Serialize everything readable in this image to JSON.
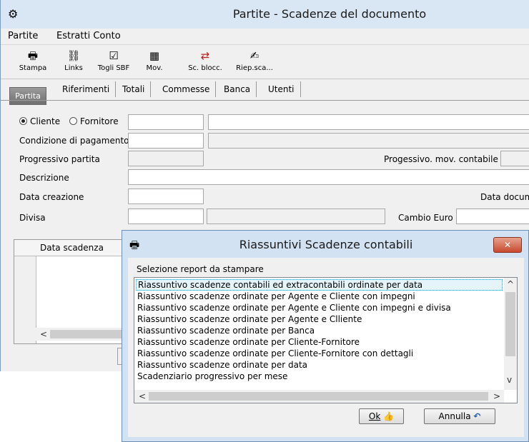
{
  "window": {
    "title": "Partite - Scadenze del documento",
    "app_icon": "gear-icon"
  },
  "menu": {
    "items": [
      "Partite",
      "Estratti Conto"
    ]
  },
  "toolbar": {
    "buttons": [
      {
        "label": "Stampa",
        "icon": "printer-icon",
        "glyph": "🖶"
      },
      {
        "label": "Links",
        "icon": "links-icon",
        "glyph": "⛓"
      },
      {
        "label": "Togli SBF",
        "icon": "checkbox-icon",
        "glyph": "☑"
      },
      {
        "label": "Mov.",
        "icon": "calculator-icon",
        "glyph": "▦"
      },
      {
        "label": "Sc. blocc.",
        "icon": "sync-icon",
        "glyph": "⇄"
      },
      {
        "label": "Riep.sca...",
        "icon": "summary-icon",
        "glyph": "✍"
      }
    ]
  },
  "tabs": {
    "active": "Partita",
    "others": [
      "Riferimenti",
      "Totali",
      "Commesse",
      "Banca",
      "Utenti"
    ]
  },
  "form": {
    "cliente": "Cliente",
    "fornitore": "Fornitore",
    "condizione": "Condizione di pagamento",
    "progressivo_partita": "Progressivo partita",
    "progressivo_mov": "Progessivo. mov. contabile",
    "descrizione": "Descrizione",
    "data_creazione": "Data creazione",
    "data_documento": "Data docum",
    "divisa": "Divisa",
    "cambio_euro": "Cambio Euro"
  },
  "grid": {
    "column": "Data scadenza",
    "scroll_left": "<"
  },
  "dialog": {
    "title": "Riassuntivi Scadenze contabili",
    "icon": "printer-icon",
    "close_glyph": "✕",
    "label": "Selezione report da stampare",
    "items": [
      "Riassuntivo scadenze contabili ed extracontabili ordinate per data",
      "Riassuntivo scadenze ordinate per Agente e Cliente con impegni",
      "Riassuntivo scadenze ordinate per Agente e Cliente con impegni e divisa",
      "Riassuntivo scadenze ordinate per Agente e Clliente",
      "Riassuntivo scadenze ordinate per Banca",
      "Riassuntivo scadenze ordinate per Cliente-Fornitore",
      "Riassuntivo scadenze ordinate per Cliente-Fornitore con dettagli",
      "Riassuntivo scadenze ordinate per data",
      "Scadenziario progressivo per mese"
    ],
    "selected_index": 0,
    "scroll_up": "^",
    "scroll_down": "v",
    "scroll_left": "<",
    "scroll_right": ">",
    "ok_label": "Ok",
    "annulla_label": "Annulla"
  }
}
